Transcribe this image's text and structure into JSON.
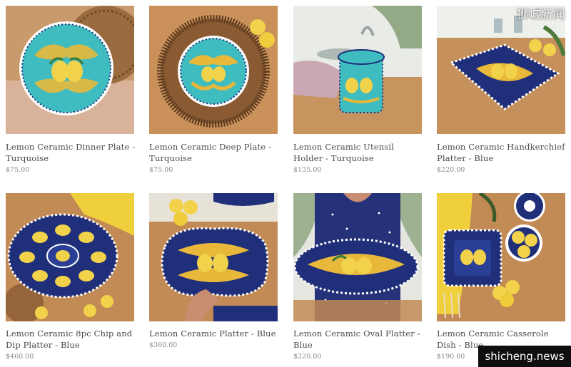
{
  "products": [
    {
      "title": "Lemon Ceramic Dinner Plate - Turquoise",
      "price": "$75.00",
      "image": "turquoise-dinner-plate-photo"
    },
    {
      "title": "Lemon Ceramic Deep Plate - Turquoise",
      "price": "$75.00",
      "image": "turquoise-deep-plate-photo"
    },
    {
      "title": "Lemon Ceramic Utensil Holder - Turquoise",
      "price": "$135.00",
      "image": "turquoise-utensil-holder-photo"
    },
    {
      "title": "Lemon Ceramic Handkerchief Platter - Blue",
      "price": "$220.00",
      "image": "blue-handkerchief-platter-photo"
    },
    {
      "title": "Lemon Ceramic 8pc Chip and Dip Platter - Blue",
      "price": "$460.00",
      "image": "blue-chip-and-dip-platter-photo"
    },
    {
      "title": "Lemon Ceramic Platter - Blue",
      "price": "$360.00",
      "image": "blue-platter-photo"
    },
    {
      "title": "Lemon Ceramic Oval Platter - Blue",
      "price": "$220.00",
      "image": "blue-oval-platter-photo"
    },
    {
      "title": "Lemon Ceramic Casserole Dish - Blue",
      "price": "$190.00",
      "image": "blue-casserole-dish-photo"
    }
  ],
  "watermark": {
    "top": "狮城新闻",
    "bottom": "shicheng.news"
  },
  "colors": {
    "turquoise": "#3fbcc0",
    "cobalt": "#1f2f7a",
    "lemon": "#f2d24b",
    "wood": "#c7935e"
  }
}
